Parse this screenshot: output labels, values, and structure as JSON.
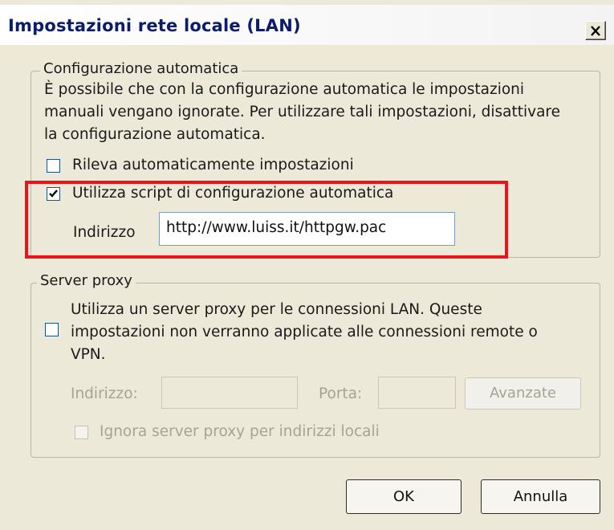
{
  "window": {
    "title": "Impostazioni rete locale (LAN)",
    "close_icon": "close-icon"
  },
  "auto_config": {
    "legend": "Configurazione automatica",
    "description_lines": [
      "È possibile che con la configurazione automatica le impostazioni",
      "manuali vengano ignorate. Per utilizzare tali impostazioni, disattivare",
      "la configurazione automatica."
    ],
    "detect_label": "Rileva automaticamente impostazioni",
    "detect_checked": false,
    "script_label": "Utilizza script di configurazione automatica",
    "script_checked": true,
    "address_label": "Indirizzo",
    "address_value": "http://www.luiss.it/httpgw.pac"
  },
  "proxy": {
    "legend": "Server proxy",
    "use_proxy_lines": [
      "Utilizza un server proxy per le connessioni LAN. Queste",
      "impostazioni non verranno applicate alle connessioni remote o",
      "VPN."
    ],
    "use_proxy_checked": false,
    "address_label": "Indirizzo:",
    "address_value": "",
    "port_label": "Porta:",
    "port_value": "",
    "advanced_label": "Avanzate",
    "bypass_label": "Ignora server proxy per indirizzi locali",
    "bypass_checked": false
  },
  "buttons": {
    "ok_label": "OK",
    "cancel_label": "Annulla"
  },
  "colors": {
    "highlight": "#e8141b",
    "dialog_bg": "#ece9d8",
    "title_text": "#0a1c6b"
  }
}
